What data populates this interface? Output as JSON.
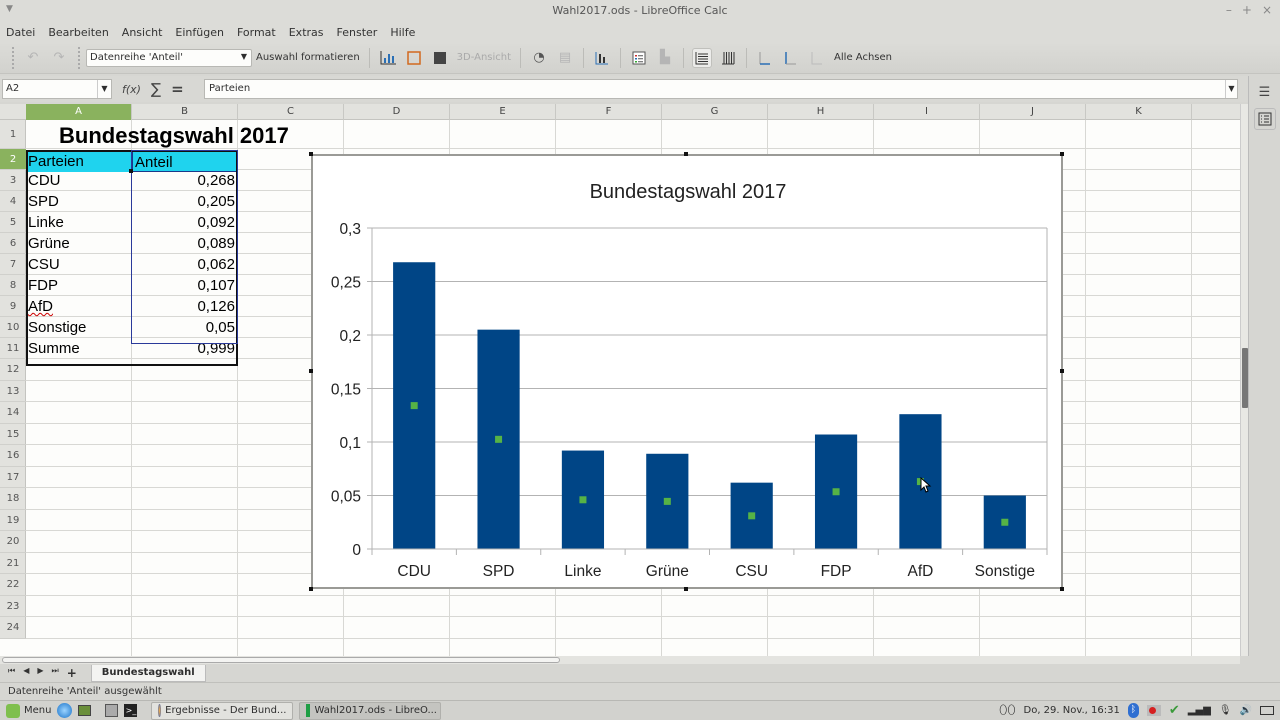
{
  "window": {
    "title": "Wahl2017.ods - LibreOffice Calc",
    "controls": [
      "–",
      "+",
      "×"
    ]
  },
  "menu": [
    "Datei",
    "Bearbeiten",
    "Ansicht",
    "Einfügen",
    "Format",
    "Extras",
    "Fenster",
    "Hilfe"
  ],
  "toolbar": {
    "element_select": "Datenreihe 'Anteil'",
    "format_selection": "Auswahl formatieren",
    "view3d": "3D-Ansicht",
    "all_axes": "Alle Achsen"
  },
  "formula_bar": {
    "name_box": "A2",
    "fx": "f(x)",
    "sigma": "∑",
    "equals": "=",
    "content": "Parteien"
  },
  "columns": [
    "A",
    "B",
    "C",
    "D",
    "E",
    "F",
    "G",
    "H",
    "I",
    "J",
    "K"
  ],
  "rows": [
    "1",
    "2",
    "3",
    "4",
    "5",
    "6",
    "7",
    "8",
    "9",
    "10",
    "11",
    "12",
    "13",
    "14",
    "15",
    "16",
    "17",
    "18",
    "19",
    "20",
    "21",
    "22",
    "23",
    "24"
  ],
  "sheet": {
    "title": "Bundestagswahl 2017",
    "header": [
      "Parteien",
      "Anteil"
    ],
    "data": [
      [
        "CDU",
        "0,268"
      ],
      [
        "SPD",
        "0,205"
      ],
      [
        "Linke",
        "0,092"
      ],
      [
        "Grüne",
        "0,089"
      ],
      [
        "CSU",
        "0,062"
      ],
      [
        "FDP",
        "0,107"
      ],
      [
        "AfD",
        "0,126"
      ],
      [
        "Sonstige",
        "0,05"
      ]
    ],
    "total": [
      "Summe",
      "0,999"
    ]
  },
  "chart_data": {
    "type": "bar",
    "title": "Bundestagswahl 2017",
    "categories": [
      "CDU",
      "SPD",
      "Linke",
      "Grüne",
      "CSU",
      "FDP",
      "AfD",
      "Sonstige"
    ],
    "series": [
      {
        "name": "Anteil",
        "values": [
          0.268,
          0.205,
          0.092,
          0.089,
          0.062,
          0.107,
          0.126,
          0.05
        ],
        "color": "#004586"
      }
    ],
    "ylim": [
      0,
      0.3
    ],
    "yticks": [
      "0",
      "0,05",
      "0,1",
      "0,15",
      "0,2",
      "0,25",
      "0,3"
    ],
    "ytick_values": [
      0,
      0.05,
      0.1,
      0.15,
      0.2,
      0.25,
      0.3
    ],
    "xlabel": "",
    "ylabel": "",
    "grid": true,
    "legend": "none",
    "selected_series_marker_color": "#56b346"
  },
  "sheet_tabs": [
    "Bundestagswahl"
  ],
  "status": "Datenreihe 'Anteil' ausgewählt",
  "taskbar": {
    "menu": "Menu",
    "windows": [
      "Ergebnisse - Der Bund...",
      "Wahl2017.ods - LibreO..."
    ],
    "clock": "Do, 29. Nov., 16:31"
  }
}
